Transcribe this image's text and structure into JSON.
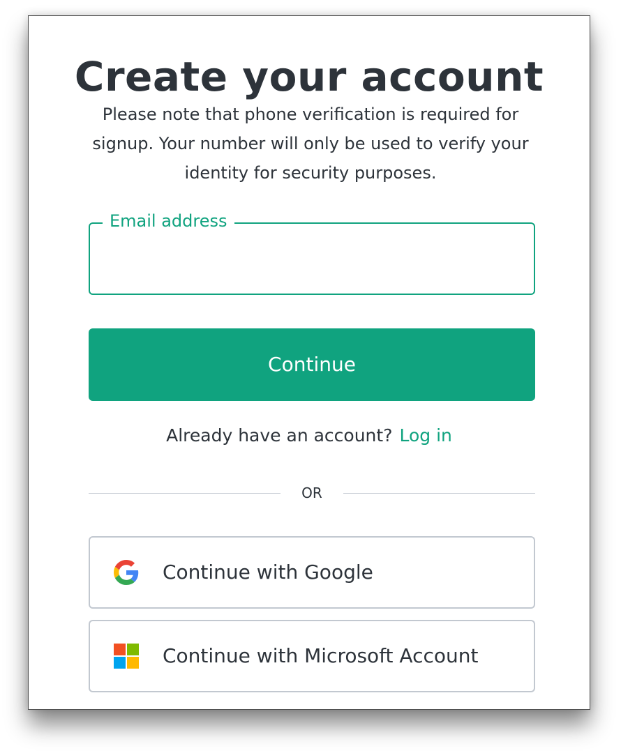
{
  "signup": {
    "title": "Create your account",
    "subtitle": "Please note that phone verification is required for signup. Your number will only be used to verify your identity for security purposes.",
    "email_field": {
      "label": "Email address",
      "value": ""
    },
    "continue_label": "Continue",
    "login_prompt": "Already have an account?",
    "login_link": "Log in",
    "divider_text": "OR",
    "social": {
      "google_label": "Continue with Google",
      "microsoft_label": "Continue with Microsoft Account"
    }
  },
  "colors": {
    "accent": "#10a37f",
    "text": "#2d333a",
    "border": "#c2c8d0"
  },
  "icons": {
    "google": "google-g-logo",
    "microsoft": "microsoft-four-square-logo"
  }
}
